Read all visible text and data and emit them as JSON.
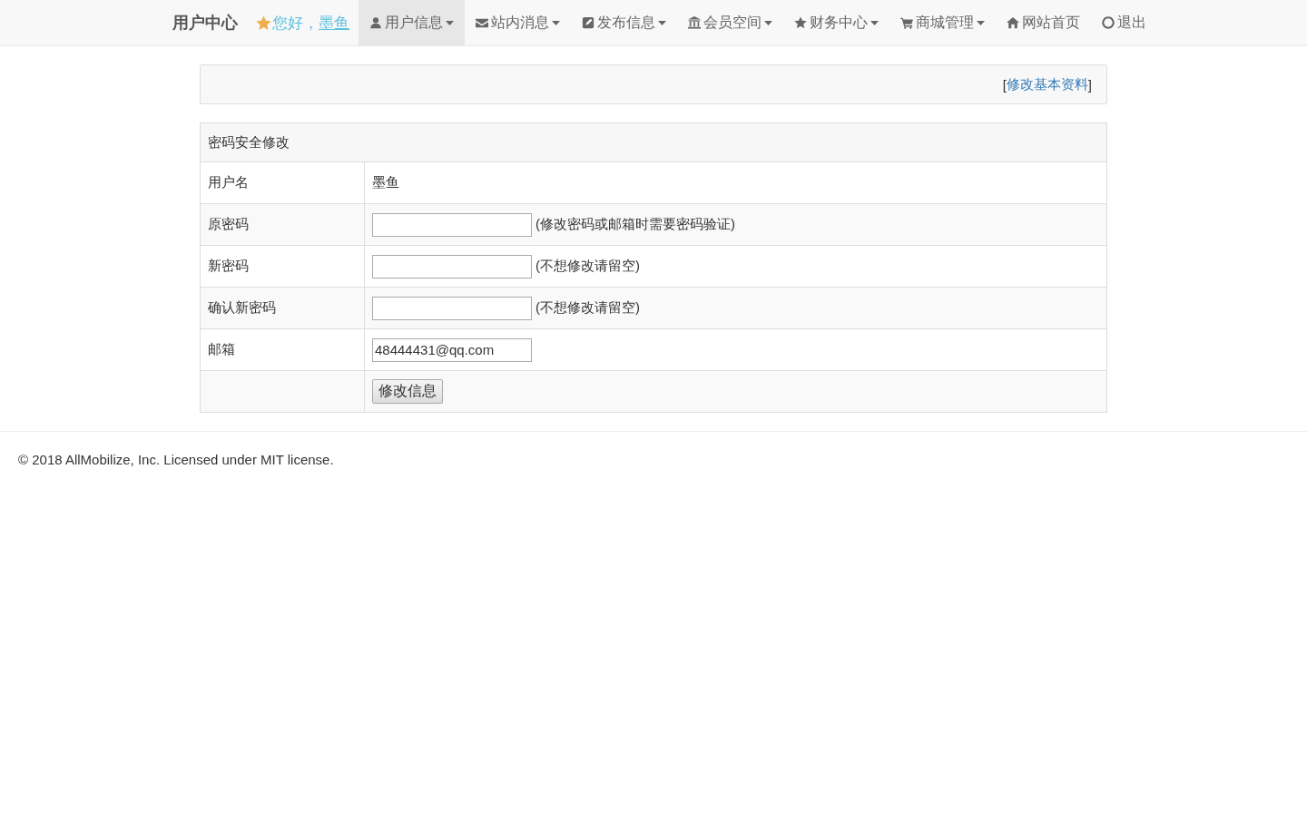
{
  "navbar": {
    "brand": "用户中心",
    "greeting": "您好，",
    "user_link": "墨鱼",
    "items": [
      {
        "label": "用户信息",
        "dropdown": true,
        "selected": true
      },
      {
        "label": "站内消息",
        "dropdown": true,
        "selected": false
      },
      {
        "label": "发布信息",
        "dropdown": true,
        "selected": false
      },
      {
        "label": "会员空间",
        "dropdown": true,
        "selected": false
      },
      {
        "label": "财务中心",
        "dropdown": true,
        "selected": false
      },
      {
        "label": "商城管理",
        "dropdown": true,
        "selected": false
      },
      {
        "label": "网站首页",
        "dropdown": false,
        "selected": false
      },
      {
        "label": "退出",
        "dropdown": false,
        "selected": false
      }
    ]
  },
  "toolbar": {
    "open_bracket": "[",
    "link": "修改基本资料",
    "close_bracket": "]"
  },
  "form": {
    "title": "密码安全修改",
    "rows": [
      {
        "kind": "text",
        "label": "用户名",
        "value": "墨鱼"
      },
      {
        "kind": "field",
        "label": "原密码",
        "hint": "(修改密码或邮箱时需要密码验证)"
      },
      {
        "kind": "field",
        "label": "新密码",
        "hint": "(不想修改请留空)"
      },
      {
        "kind": "field",
        "label": "确认新密码",
        "hint": "(不想修改请留空)"
      },
      {
        "kind": "field",
        "label": "邮箱",
        "value": "48444431@qq.com"
      },
      {
        "kind": "button",
        "value": "修改信息"
      }
    ]
  },
  "footer": {
    "text": "© 2018 AllMobilize, Inc. Licensed under MIT license."
  }
}
